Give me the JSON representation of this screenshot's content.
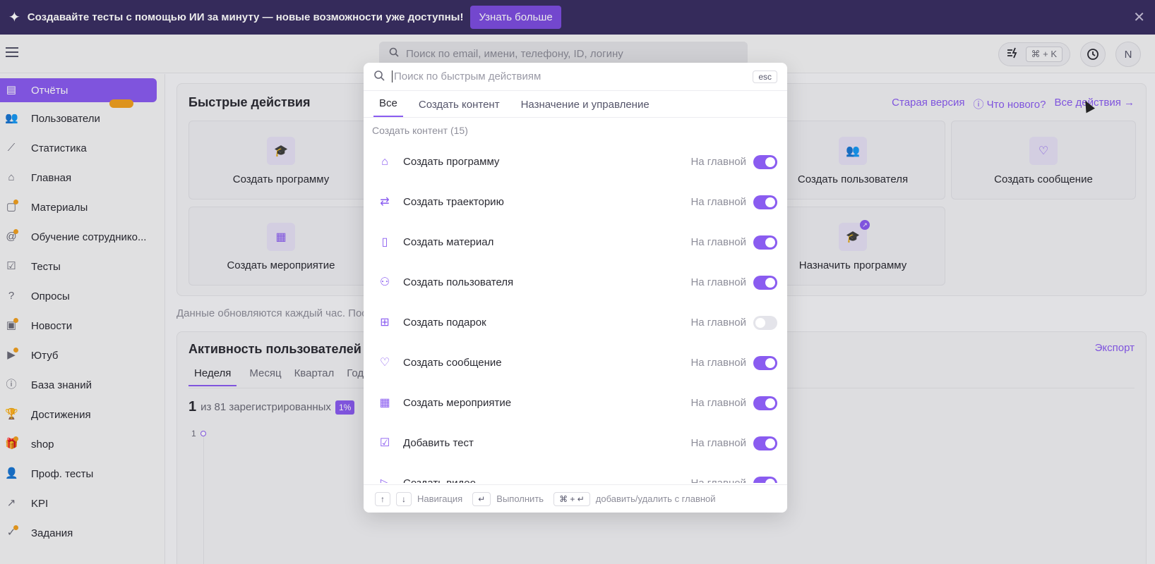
{
  "banner": {
    "text": "Создавайте тесты с помощью ИИ за минуту — новые возможности уже доступны!",
    "button": "Узнать больше",
    "close": "✕"
  },
  "topbar": {
    "search_placeholder": "Поиск по email, имени, телефону, ID, логину",
    "shortcut": "⌘ + K",
    "avatar": "N"
  },
  "sidebar": {
    "items": [
      {
        "label": "Отчёты",
        "icon": "reports-icon"
      },
      {
        "label": "Пользователи",
        "icon": "users-icon"
      },
      {
        "label": "Статистика",
        "icon": "chart-icon"
      },
      {
        "label": "Главная",
        "icon": "home-icon"
      },
      {
        "label": "Материалы",
        "icon": "document-icon"
      },
      {
        "label": "Обучение сотруднико...",
        "icon": "at-icon"
      },
      {
        "label": "Тесты",
        "icon": "test-icon"
      },
      {
        "label": "Опросы",
        "icon": "question-icon"
      },
      {
        "label": "Новости",
        "icon": "news-icon"
      },
      {
        "label": "Ютуб",
        "icon": "video-icon"
      },
      {
        "label": "База знаний",
        "icon": "info-icon"
      },
      {
        "label": "Достижения",
        "icon": "trophy-icon"
      },
      {
        "label": "shop",
        "icon": "gift-icon"
      },
      {
        "label": "Проф. тесты",
        "icon": "user-check-icon"
      },
      {
        "label": "KPI",
        "icon": "trend-icon"
      },
      {
        "label": "Задания",
        "icon": "check-circle-icon"
      }
    ]
  },
  "quick_actions": {
    "title": "Быстрые действия",
    "links": [
      "Старая версия",
      "ⓘ Что нового?",
      "Все действия →"
    ],
    "tiles": [
      "Создать программу",
      "Создать пользователя",
      "Создать сообщение",
      "Создать мероприятие",
      "Назначить программу"
    ]
  },
  "update_note": "Данные обновляются каждый час. Пос",
  "activity": {
    "title": "Активность пользователей",
    "export": "Экспорт",
    "tabs": [
      "Неделя",
      "Месяц",
      "Квартал",
      "Год"
    ],
    "count": "1",
    "count_label": "из 81 зарегистрированных",
    "percent": "1%",
    "axis_value": "1"
  },
  "palette": {
    "search_placeholder": "Поиск по быстрым действиям",
    "esc": "esc",
    "tabs": [
      "Все",
      "Создать контент",
      "Назначение и управление"
    ],
    "group": "Создать контент  (15)",
    "meta": "На главной",
    "items": [
      {
        "label": "Создать программу",
        "icon": "graduation-cap-icon",
        "on": true
      },
      {
        "label": "Создать траекторию",
        "icon": "route-icon",
        "on": true
      },
      {
        "label": "Создать материал",
        "icon": "document-icon",
        "on": true
      },
      {
        "label": "Создать пользователя",
        "icon": "users-icon",
        "on": true
      },
      {
        "label": "Создать подарок",
        "icon": "gift-icon",
        "on": false
      },
      {
        "label": "Создать сообщение",
        "icon": "message-heart-icon",
        "on": true
      },
      {
        "label": "Создать мероприятие",
        "icon": "calendar-icon",
        "on": true
      },
      {
        "label": "Добавить тест",
        "icon": "test-icon",
        "on": true
      },
      {
        "label": "Создать видео",
        "icon": "video-icon",
        "on": true
      }
    ],
    "footer": {
      "up": "↑",
      "down": "↓",
      "nav": "Навигация",
      "enter": "↵",
      "run": "Выполнить",
      "combo": "⌘ + ↵",
      "toggle_label": "добавить/удалить с главной"
    }
  }
}
